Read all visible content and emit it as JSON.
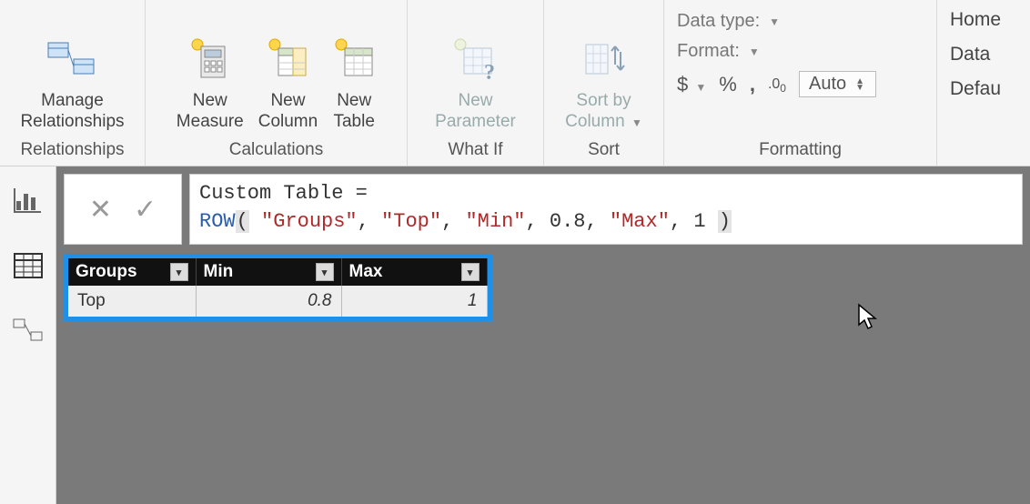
{
  "ribbon": {
    "groups": {
      "relationships": {
        "label": "Relationships",
        "manage": "Manage\nRelationships"
      },
      "calculations": {
        "label": "Calculations",
        "new_measure": "New\nMeasure",
        "new_column": "New\nColumn",
        "new_table": "New\nTable"
      },
      "whatif": {
        "label": "What If",
        "new_parameter": "New\nParameter"
      },
      "sort": {
        "label": "Sort",
        "sort_by_column": "Sort by\nColumn"
      },
      "formatting": {
        "label": "Formatting",
        "data_type": "Data type:",
        "format": "Format:",
        "currency": "$",
        "percent": "%",
        "comma": ",",
        "decimals": ".00",
        "auto": "Auto"
      }
    },
    "right": {
      "home": "Home",
      "data": "Data",
      "default": "Defau"
    }
  },
  "formula": {
    "lhs": "Custom Table",
    "eq": "=",
    "fn": "ROW",
    "args": [
      "\"Groups\"",
      "\"Top\"",
      "\"Min\"",
      "0.8",
      "\"Max\"",
      "1"
    ]
  },
  "table": {
    "headers": [
      "Groups",
      "Min",
      "Max"
    ],
    "rows": [
      {
        "groups": "Top",
        "min": "0.8",
        "max": "1"
      }
    ]
  }
}
